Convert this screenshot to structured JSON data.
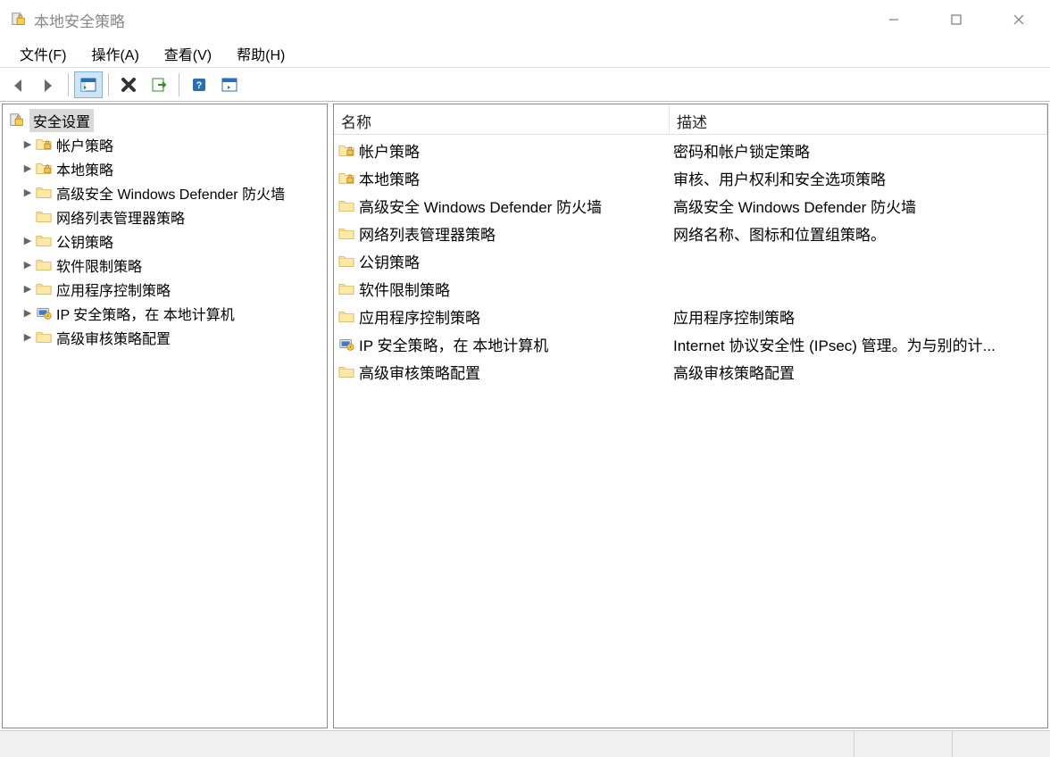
{
  "window": {
    "title": "本地安全策略"
  },
  "menu": {
    "file": "文件(F)",
    "action": "操作(A)",
    "view": "查看(V)",
    "help": "帮助(H)"
  },
  "tree": {
    "root": {
      "label": "安全设置"
    },
    "items": [
      {
        "label": "帐户策略",
        "expandable": true,
        "icon": "folder-locked"
      },
      {
        "label": "本地策略",
        "expandable": true,
        "icon": "folder-locked"
      },
      {
        "label": "高级安全 Windows Defender 防火墙",
        "expandable": true,
        "icon": "folder"
      },
      {
        "label": "网络列表管理器策略",
        "expandable": false,
        "icon": "folder"
      },
      {
        "label": "公钥策略",
        "expandable": true,
        "icon": "folder"
      },
      {
        "label": "软件限制策略",
        "expandable": true,
        "icon": "folder"
      },
      {
        "label": "应用程序控制策略",
        "expandable": true,
        "icon": "folder"
      },
      {
        "label": "IP 安全策略，在 本地计算机",
        "expandable": true,
        "icon": "ipsec"
      },
      {
        "label": "高级审核策略配置",
        "expandable": true,
        "icon": "folder"
      }
    ]
  },
  "columns": {
    "name": "名称",
    "desc": "描述"
  },
  "rows": [
    {
      "name": "帐户策略",
      "desc": "密码和帐户锁定策略",
      "icon": "folder-locked"
    },
    {
      "name": "本地策略",
      "desc": "审核、用户权利和安全选项策略",
      "icon": "folder-locked"
    },
    {
      "name": "高级安全 Windows Defender 防火墙",
      "desc": "高级安全 Windows Defender 防火墙",
      "icon": "folder"
    },
    {
      "name": "网络列表管理器策略",
      "desc": "网络名称、图标和位置组策略。",
      "icon": "folder"
    },
    {
      "name": "公钥策略",
      "desc": "",
      "icon": "folder"
    },
    {
      "name": "软件限制策略",
      "desc": "",
      "icon": "folder"
    },
    {
      "name": "应用程序控制策略",
      "desc": "应用程序控制策略",
      "icon": "folder"
    },
    {
      "name": "IP 安全策略，在 本地计算机",
      "desc": "Internet 协议安全性 (IPsec) 管理。为与别的计...",
      "icon": "ipsec"
    },
    {
      "name": "高级审核策略配置",
      "desc": "高级审核策略配置",
      "icon": "folder"
    }
  ]
}
